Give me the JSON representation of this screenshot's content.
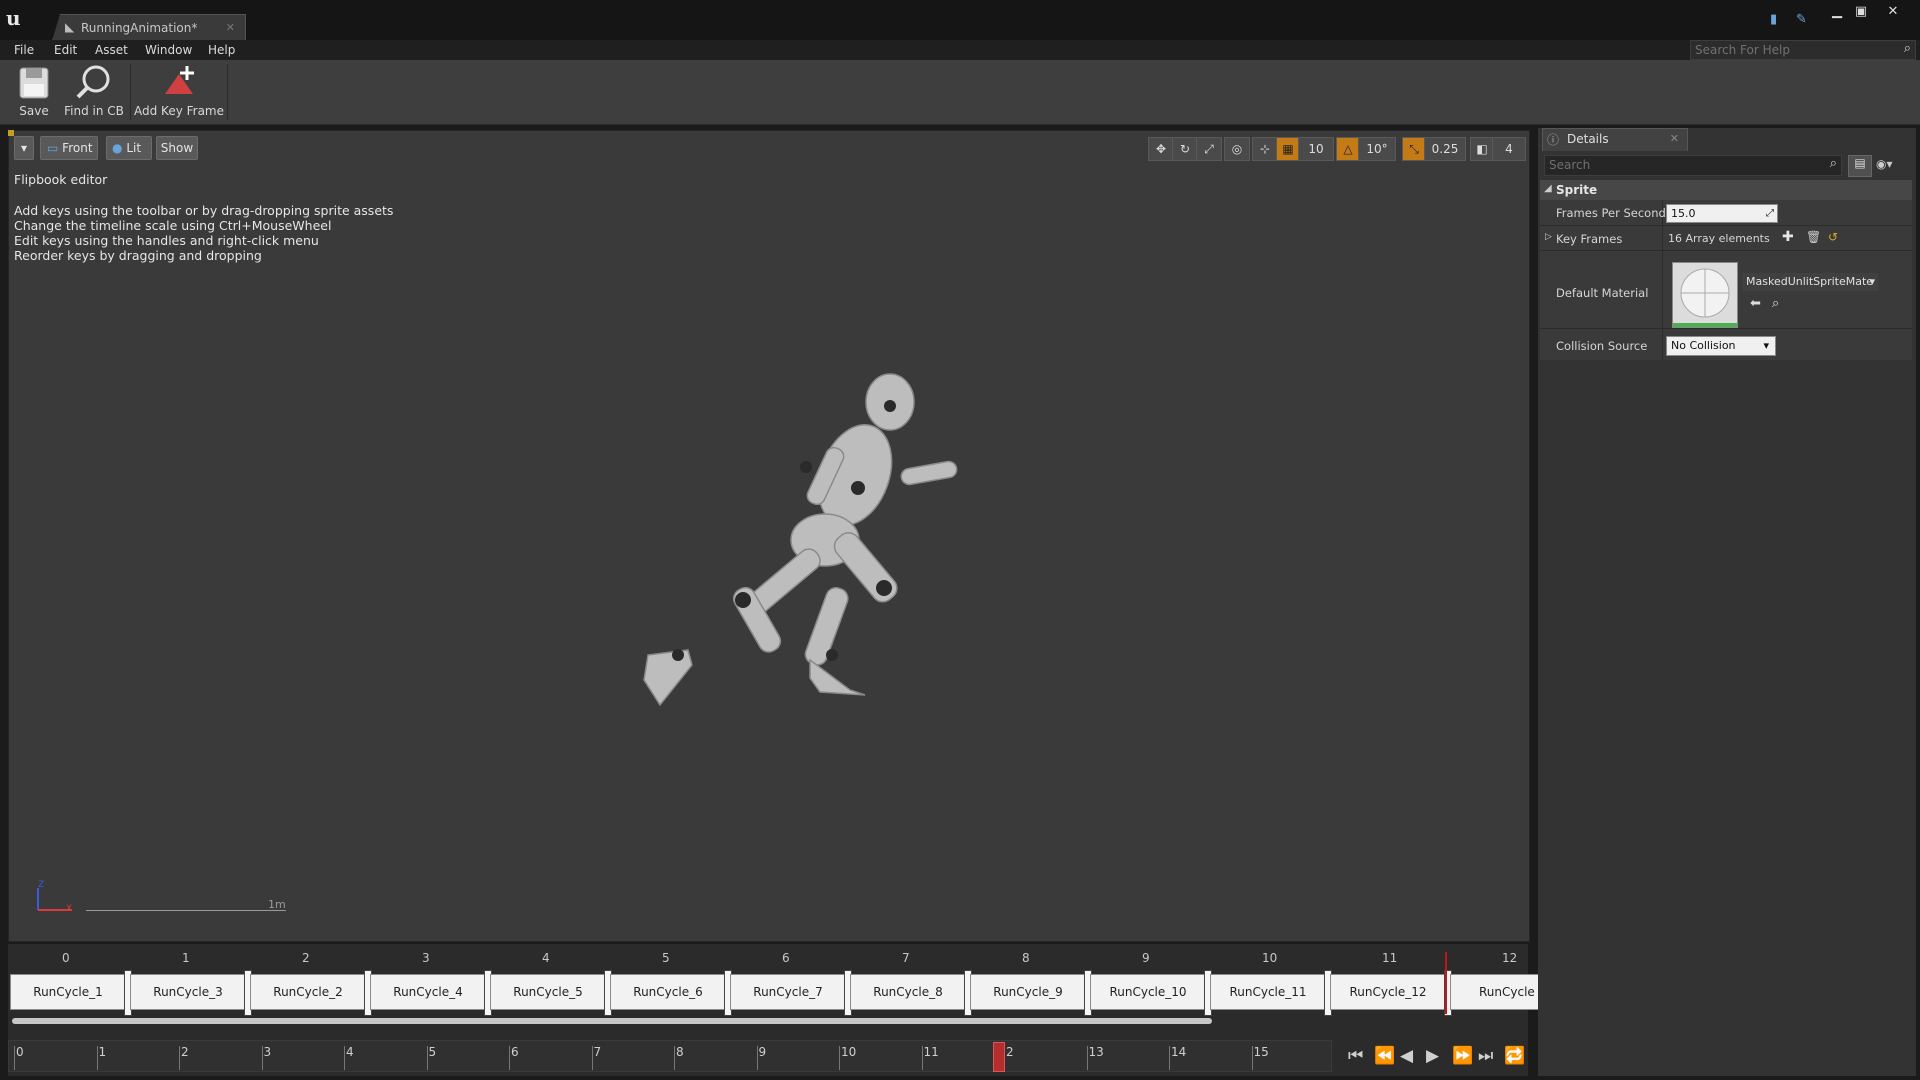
{
  "window": {
    "tab_title": "RunningAnimation*",
    "tab_icon": "flipbook-icon",
    "controls": [
      "minimize-icon",
      "maximize-icon",
      "close-icon"
    ]
  },
  "menu": {
    "items": [
      "File",
      "Edit",
      "Asset",
      "Window",
      "Help"
    ],
    "search_placeholder": "Search For Help"
  },
  "toolbar": {
    "save": "Save",
    "find_in_cb": "Find in CB",
    "add_key_frame": "Add Key Frame"
  },
  "viewport": {
    "view_mode": "Front",
    "lighting": "Lit",
    "show": "Show",
    "info_title": "Flipbook editor",
    "info_lines": [
      "Add keys using the toolbar or by drag-dropping sprite assets",
      "Change the timeline scale using Ctrl+MouseWheel",
      "Edit keys using the handles and right-click menu",
      "Reorder keys by dragging and dropping"
    ],
    "grid_snap": "10",
    "rotation_snap": "10°",
    "scale_snap": "0.25",
    "camera_speed": "4",
    "scale_label": "1m",
    "axis_z": "Z",
    "axis_x": "X"
  },
  "timeline": {
    "frame_indices": [
      "0",
      "1",
      "2",
      "3",
      "4",
      "5",
      "6",
      "7",
      "8",
      "9",
      "10",
      "11",
      "12"
    ],
    "frames": [
      "RunCycle_1",
      "RunCycle_3",
      "RunCycle_2",
      "RunCycle_4",
      "RunCycle_5",
      "RunCycle_6",
      "RunCycle_7",
      "RunCycle_8",
      "RunCycle_9",
      "RunCycle_10",
      "RunCycle_11",
      "RunCycle_12",
      "RunCycle"
    ],
    "scrub_ticks": [
      "0",
      "1",
      "2",
      "3",
      "4",
      "5",
      "6",
      "7",
      "8",
      "9",
      "10",
      "11",
      "2",
      "13",
      "14",
      "15"
    ]
  },
  "details": {
    "tab_title": "Details",
    "search_placeholder": "Search",
    "section": "Sprite",
    "fps_label": "Frames Per Second",
    "fps_value": "15.0",
    "keyframes_label": "Key Frames",
    "keyframes_value": "16 Array elements",
    "material_label": "Default Material",
    "material_value": "MaskedUnlitSpriteMate",
    "collision_label": "Collision Source",
    "collision_value": "No Collision"
  },
  "colors": {
    "accent_orange": "#c47b16",
    "playhead_red": "#c01818",
    "viewport_bg": "#3a3a3a"
  }
}
